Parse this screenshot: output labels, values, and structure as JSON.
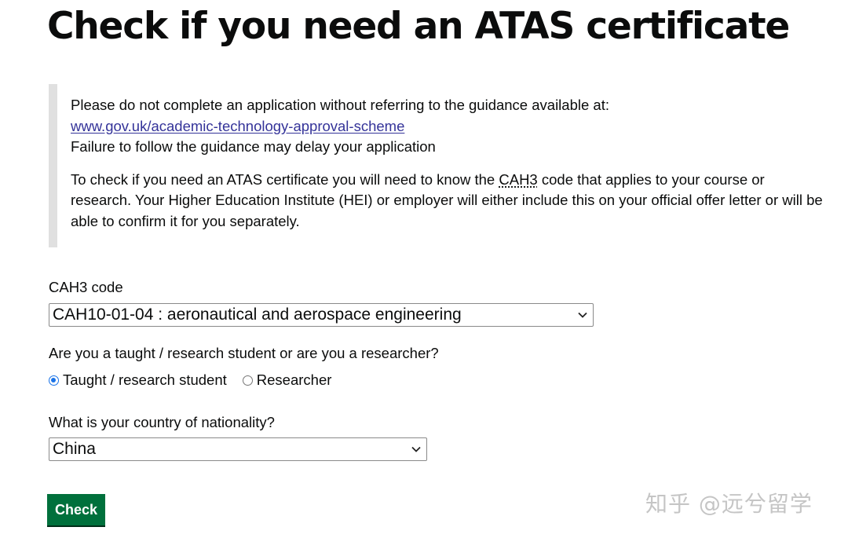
{
  "page": {
    "title": "Check if you need an ATAS certificate"
  },
  "guidance": {
    "intro": "Please do not complete an application without referring to the guidance available at:",
    "link_text": "www.gov.uk/academic-technology-approval-scheme",
    "warning": "Failure to follow the guidance may delay your application",
    "body_before": "To check if you need an ATAS certificate you will need to know the ",
    "body_abbr": "CAH3",
    "body_after": " code that applies to your course or research. Your Higher Education Institute (HEI) or employer will either include this on your official offer letter or will be able to confirm it for you separately."
  },
  "cah3_field": {
    "label": "CAH3 code",
    "selected_value": "CAH10-01-04 : aeronautical and aerospace engineering",
    "icon": "chevron-down-icon"
  },
  "status_field": {
    "question": "Are you a taught / research student or are you a researcher?",
    "options": [
      {
        "label": "Taught / research student",
        "checked": true
      },
      {
        "label": "Researcher",
        "checked": false
      }
    ]
  },
  "nationality_field": {
    "label": "What is your country of nationality?",
    "selected_value": "China",
    "icon": "chevron-down-icon"
  },
  "submit": {
    "label": "Check"
  },
  "watermark": {
    "text": "知乎 @远兮留学"
  },
  "colors": {
    "button_green": "#00703c",
    "link_blue": "#343399",
    "inset_border": "#e0e0e0",
    "radio_blue": "#1a73e8"
  }
}
